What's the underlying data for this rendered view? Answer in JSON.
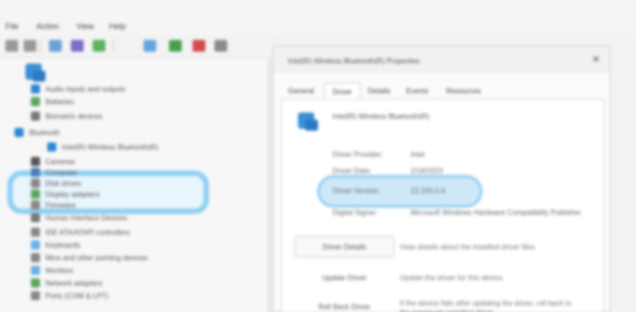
{
  "menu": [
    {
      "label": "File"
    },
    {
      "label": "Action"
    },
    {
      "label": "View"
    },
    {
      "label": "Help"
    }
  ],
  "toolbar_colors": [
    "#9a9a9a",
    "#9a9a9a",
    "#6aa0d8",
    "#7c6cc8",
    "#5fb35f",
    "#63a6e0",
    "#4aa04a",
    "#d44a4a",
    "#8a8a8a"
  ],
  "tree": {
    "nodes": [
      {
        "label": "Audio inputs and outputs",
        "color": "#2f86d4"
      },
      {
        "label": "Batteries",
        "color": "#5aa55a"
      },
      {
        "label": "Biometric devices",
        "color": "#777777"
      },
      {
        "label": "Bluetooth",
        "color": "#2f86d4"
      },
      {
        "label": "Intel(R) Wireless Bluetooth(R)",
        "color": "#2f86d4"
      },
      {
        "label": "Cameras",
        "color": "#555555"
      },
      {
        "label": "Computer",
        "color": "#4a7fb8"
      },
      {
        "label": "Disk drives",
        "color": "#888888"
      },
      {
        "label": "Display adapters",
        "color": "#5aa55a"
      },
      {
        "label": "Firmware",
        "color": "#888888"
      },
      {
        "label": "Human Interface Devices",
        "color": "#777777"
      },
      {
        "label": "IDE ATA/ATAPI controllers",
        "color": "#888888"
      },
      {
        "label": "Keyboards",
        "color": "#6ab0e8"
      },
      {
        "label": "Mice and other pointing devices",
        "color": "#888888"
      },
      {
        "label": "Monitors",
        "color": "#6ab0e8"
      },
      {
        "label": "Network adapters",
        "color": "#5aa55a"
      },
      {
        "label": "Ports (COM & LPT)",
        "color": "#888888"
      }
    ]
  },
  "props": {
    "title": "Intel(R) Wireless Bluetooth(R) Properties",
    "close_glyph": "✕",
    "tabs": [
      {
        "label": "General"
      },
      {
        "label": "Driver"
      },
      {
        "label": "Details"
      },
      {
        "label": "Events"
      },
      {
        "label": "Resources"
      }
    ],
    "device_name": "Intel(R) Wireless Bluetooth(R)",
    "rows": [
      {
        "key": "Driver Provider:",
        "value": "Intel"
      },
      {
        "key": "Driver Date:",
        "value": "2/18/2023"
      },
      {
        "key": "Driver Version:",
        "value": "22.220.0.4"
      },
      {
        "key": "Digital Signer:",
        "value": "Microsoft Windows Hardware Compatibility Publisher"
      }
    ],
    "buttons": [
      {
        "label": "Driver Details",
        "desc": "View details about the installed driver files."
      },
      {
        "label": "Update Driver",
        "desc": "Update the driver for this device."
      },
      {
        "label": "Roll Back Driver",
        "desc": "If the device fails after updating the driver, roll back to the previously installed driver."
      }
    ]
  }
}
